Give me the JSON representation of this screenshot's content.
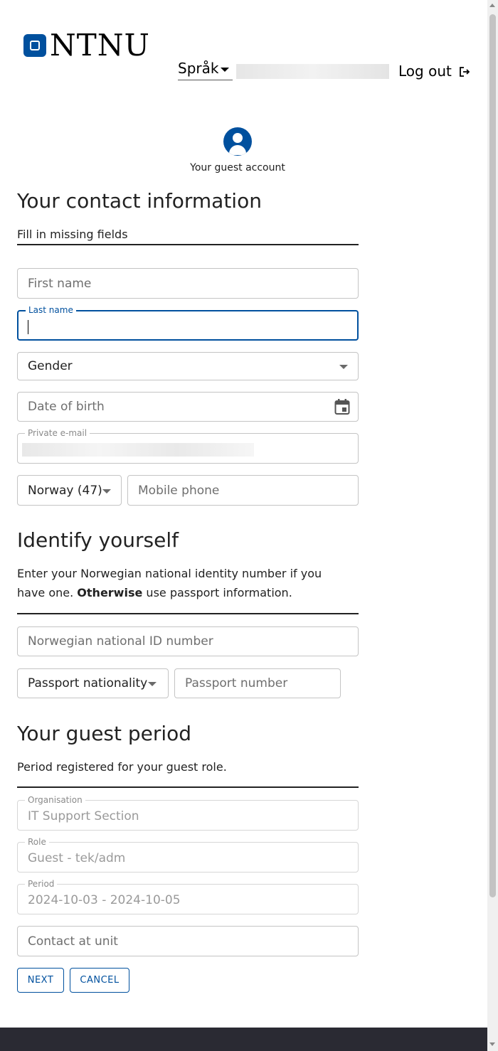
{
  "header": {
    "logo_text": "NTNU",
    "language_label": "Språk",
    "logout_label": "Log out"
  },
  "account": {
    "label": "Your guest account"
  },
  "contact": {
    "title": "Your contact information",
    "subtitle": "Fill in missing fields",
    "first_name_placeholder": "First name",
    "last_name_label": "Last name",
    "gender_value": "Gender",
    "dob_placeholder": "Date of birth",
    "email_label": "Private e-mail",
    "country_code_value": "Norway (47)",
    "mobile_placeholder": "Mobile phone"
  },
  "identify": {
    "title": "Identify yourself",
    "desc_part1": "Enter your Norwegian national identity number if you have one.",
    "desc_bold": "Otherwise",
    "desc_part2": "use passport information.",
    "national_id_placeholder": "Norwegian national ID number",
    "passport_nationality_value": "Passport nationality",
    "passport_number_placeholder": "Passport number"
  },
  "period": {
    "title": "Your guest period",
    "desc": "Period registered for your guest role.",
    "organisation_label": "Organisation",
    "organisation_value": "IT Support Section",
    "role_label": "Role",
    "role_value": "Guest - tek/adm",
    "period_label": "Period",
    "period_value": "2024-10-03 - 2024-10-05",
    "contact_placeholder": "Contact at unit"
  },
  "actions": {
    "next_label": "NEXT",
    "cancel_label": "CANCEL"
  },
  "colors": {
    "brand": "#00509e",
    "footer": "#2a2a33"
  }
}
